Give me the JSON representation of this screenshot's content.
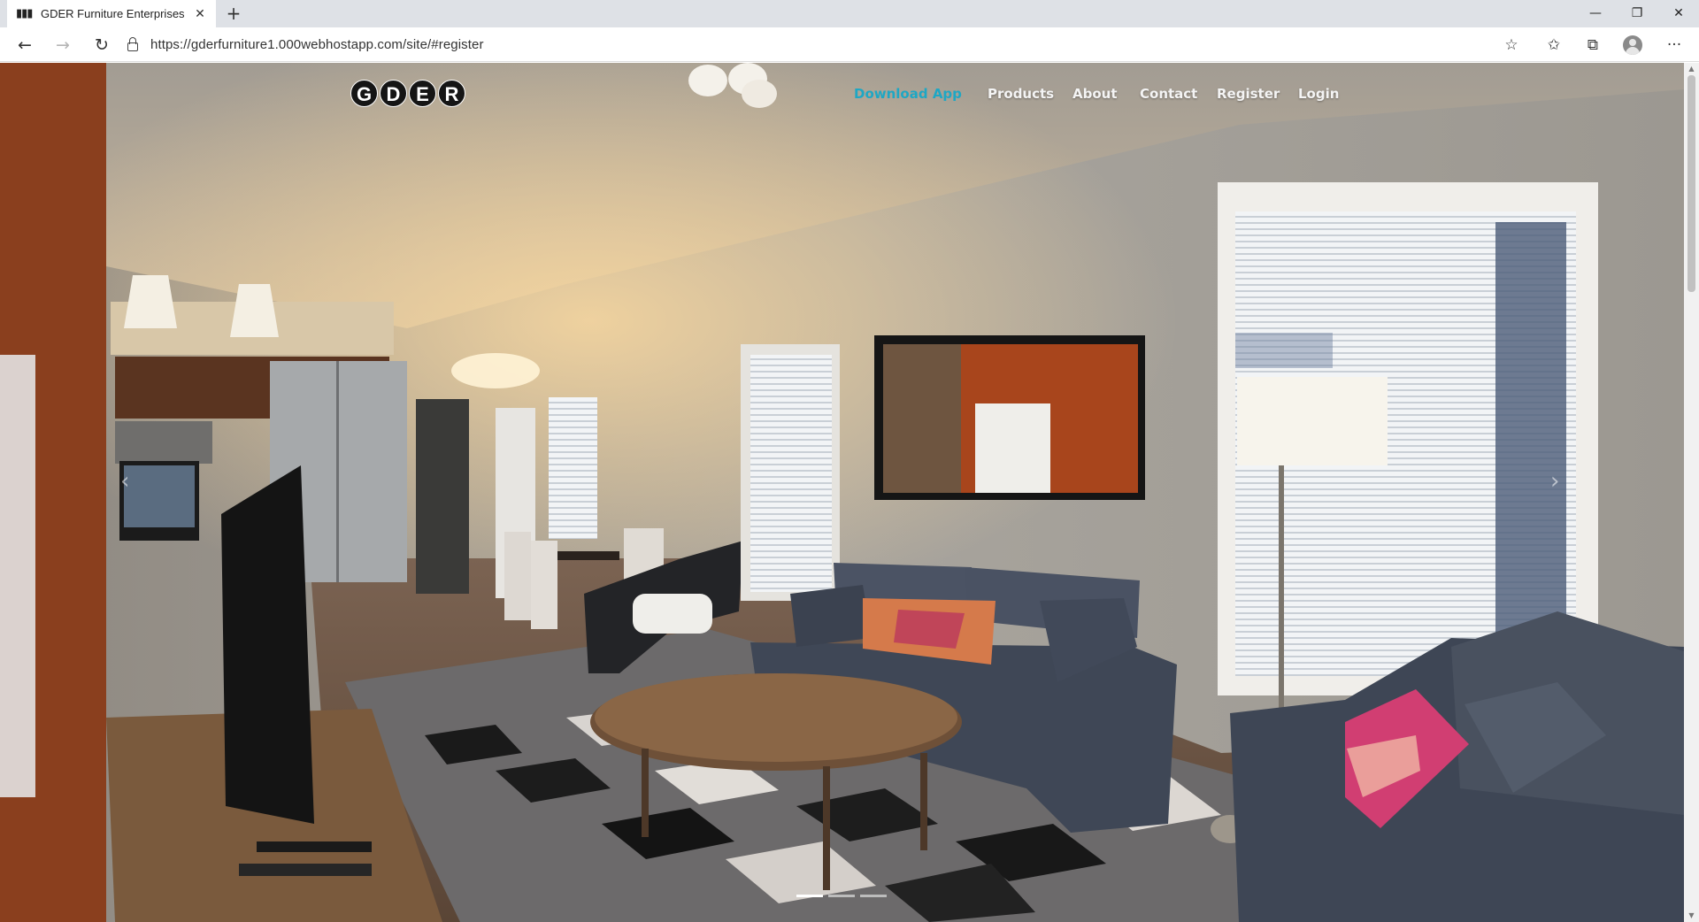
{
  "browser": {
    "tab_title": "GDER Furniture Enterprises",
    "tab_favicon": "▮▮▮",
    "close_tab_glyph": "✕",
    "new_tab_glyph": "+",
    "url": "https://gderfurniture1.000webhostapp.com/site/#register",
    "window_controls": {
      "minimize": "—",
      "restore": "❐",
      "close": "✕"
    },
    "nav": {
      "back": "←",
      "forward": "→",
      "reload": "↻"
    },
    "toolbar_icons": {
      "favorite": "☆",
      "favorites": "✩",
      "collections": "⧉",
      "more": "···"
    }
  },
  "site": {
    "logo_letters": [
      "G",
      "D",
      "E",
      "R"
    ],
    "nav": {
      "download_app": "Download App",
      "products": "Products",
      "about": "About",
      "contact": "Contact",
      "register": "Register",
      "login": "Login"
    },
    "carousel": {
      "prev_glyph": "‹",
      "next_glyph": "›",
      "slide_count": 3,
      "active_slide": 1
    },
    "colors": {
      "active_nav": "#1ea7c4"
    }
  }
}
